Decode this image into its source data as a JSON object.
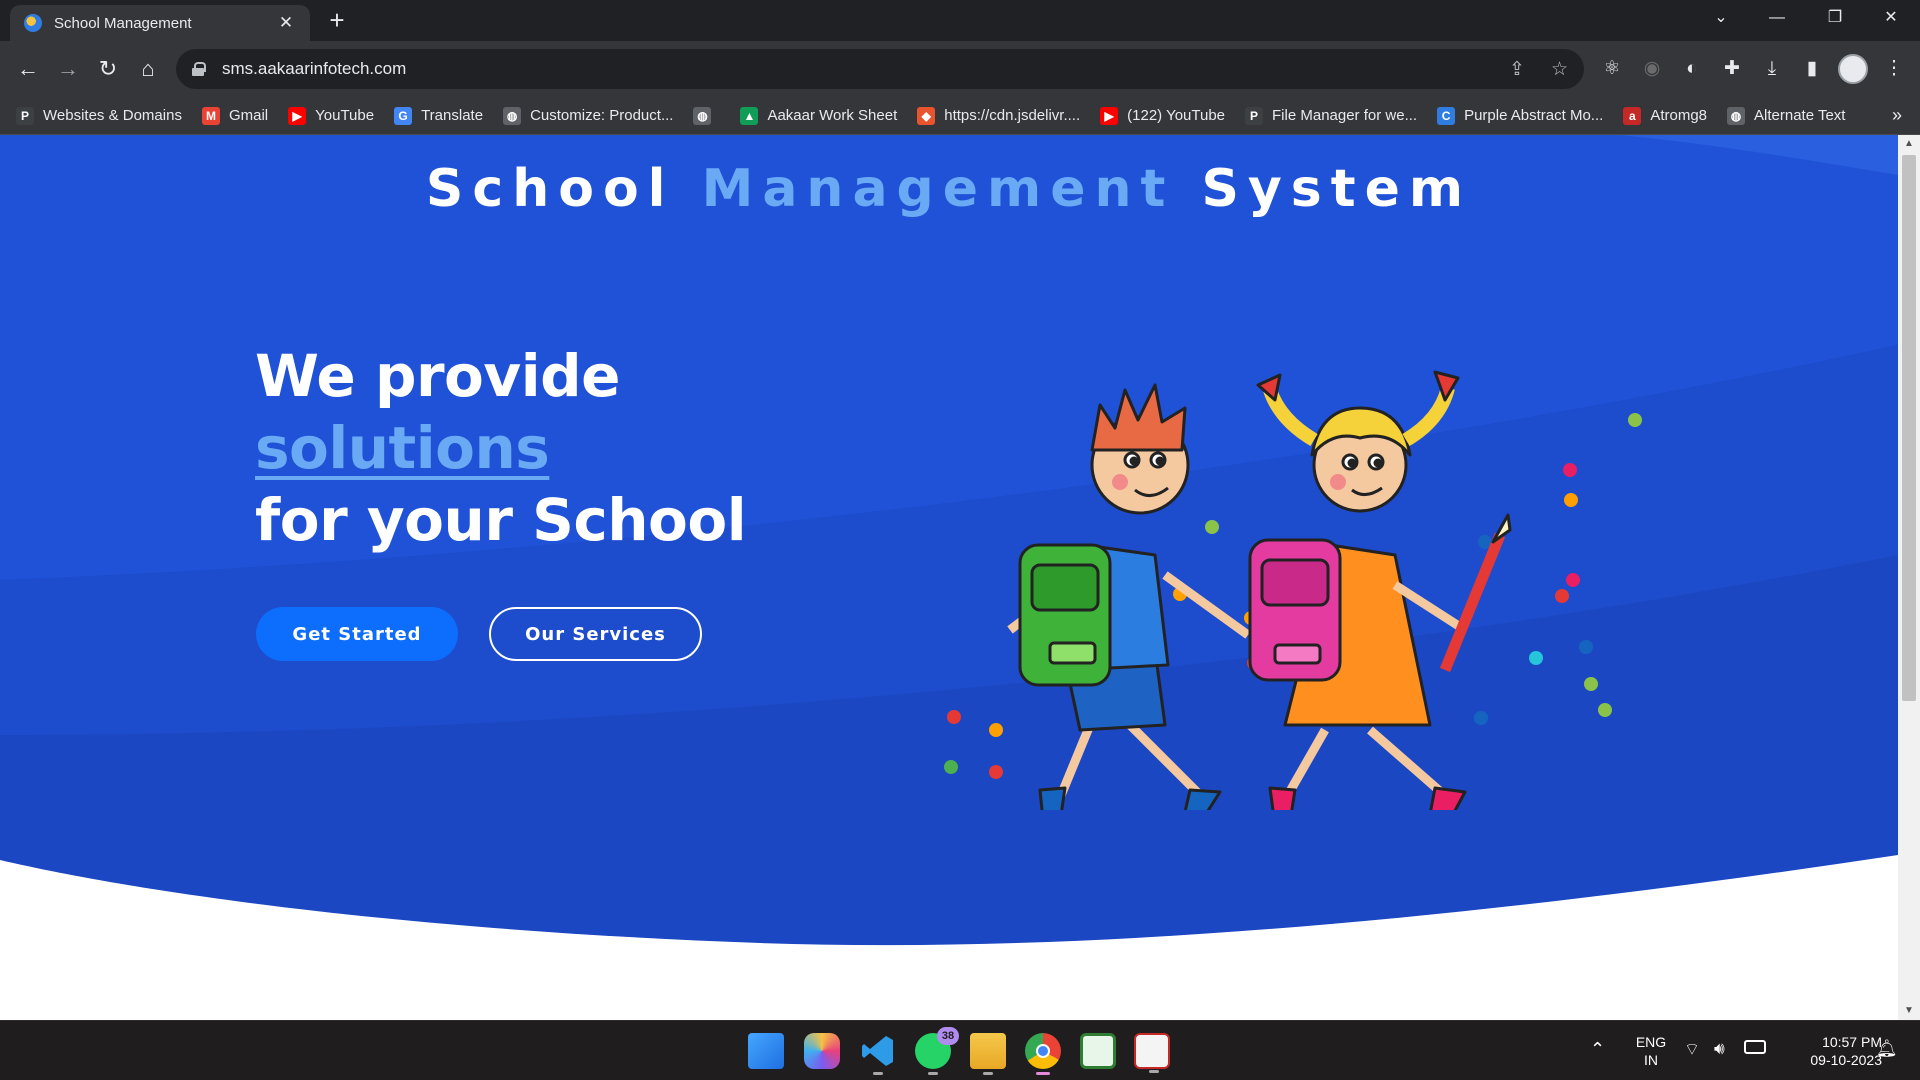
{
  "browser": {
    "tab_title": "School Management",
    "tab_close": "✕",
    "new_tab": "+",
    "url": "sms.aakaarinfotech.com",
    "window_controls": {
      "tabsearch": "⌄",
      "minimize": "—",
      "restore": "❐",
      "close": "✕"
    },
    "nav": {
      "back": "←",
      "forward": "→",
      "reload": "↻",
      "home": "⌂"
    },
    "omnibox_icons": {
      "share": "⇪",
      "bookmark_star": "☆"
    }
  },
  "bookmarks": [
    {
      "label": "Websites & Domains",
      "icon": "P",
      "color": "#3c4043"
    },
    {
      "label": "Gmail",
      "icon": "M",
      "color": "#ea4335"
    },
    {
      "label": "YouTube",
      "icon": "▶",
      "color": "#ff0000"
    },
    {
      "label": "Translate",
      "icon": "G",
      "color": "#4285f4"
    },
    {
      "label": "Customize: Product...",
      "icon": "◍",
      "color": "#5f6368"
    },
    {
      "label": "",
      "icon": "◍",
      "color": "#5f6368"
    },
    {
      "label": "Aakaar Work Sheet",
      "icon": "▲",
      "color": "#0f9d58"
    },
    {
      "label": "https://cdn.jsdelivr....",
      "icon": "◆",
      "color": "#e8542d"
    },
    {
      "label": "(122) YouTube",
      "icon": "▶",
      "color": "#ff0000"
    },
    {
      "label": "File Manager for we...",
      "icon": "P",
      "color": "#3c4043"
    },
    {
      "label": "Purple Abstract Mo...",
      "icon": "C",
      "color": "#2f7de1"
    },
    {
      "label": "Atromg8",
      "icon": "a",
      "color": "#c62828"
    },
    {
      "label": "Alternate Text",
      "icon": "◍",
      "color": "#5f6368"
    }
  ],
  "bookmarks_more": "»",
  "hero": {
    "brand_part1": "School ",
    "brand_part2": "Management",
    "brand_part3": " System",
    "headline_line1": "We provide",
    "headline_line2": "solutions",
    "headline_line3": "for your School",
    "primary_button": "Get Started",
    "secondary_button": "Our Services"
  },
  "colors": {
    "hero_blue": "#1e4fd0",
    "accent": "#6aaaf5",
    "primary_button": "#0d6efd"
  },
  "taskbar": {
    "apps": [
      "windows-start",
      "copilot",
      "vscode",
      "whatsapp",
      "file-explorer",
      "chrome",
      "notepad-green",
      "snipping-tool"
    ],
    "whatsapp_badge": "38",
    "language_line1": "ENG",
    "language_line2": "IN",
    "time": "10:57 PM",
    "date": "09-10-2023"
  }
}
